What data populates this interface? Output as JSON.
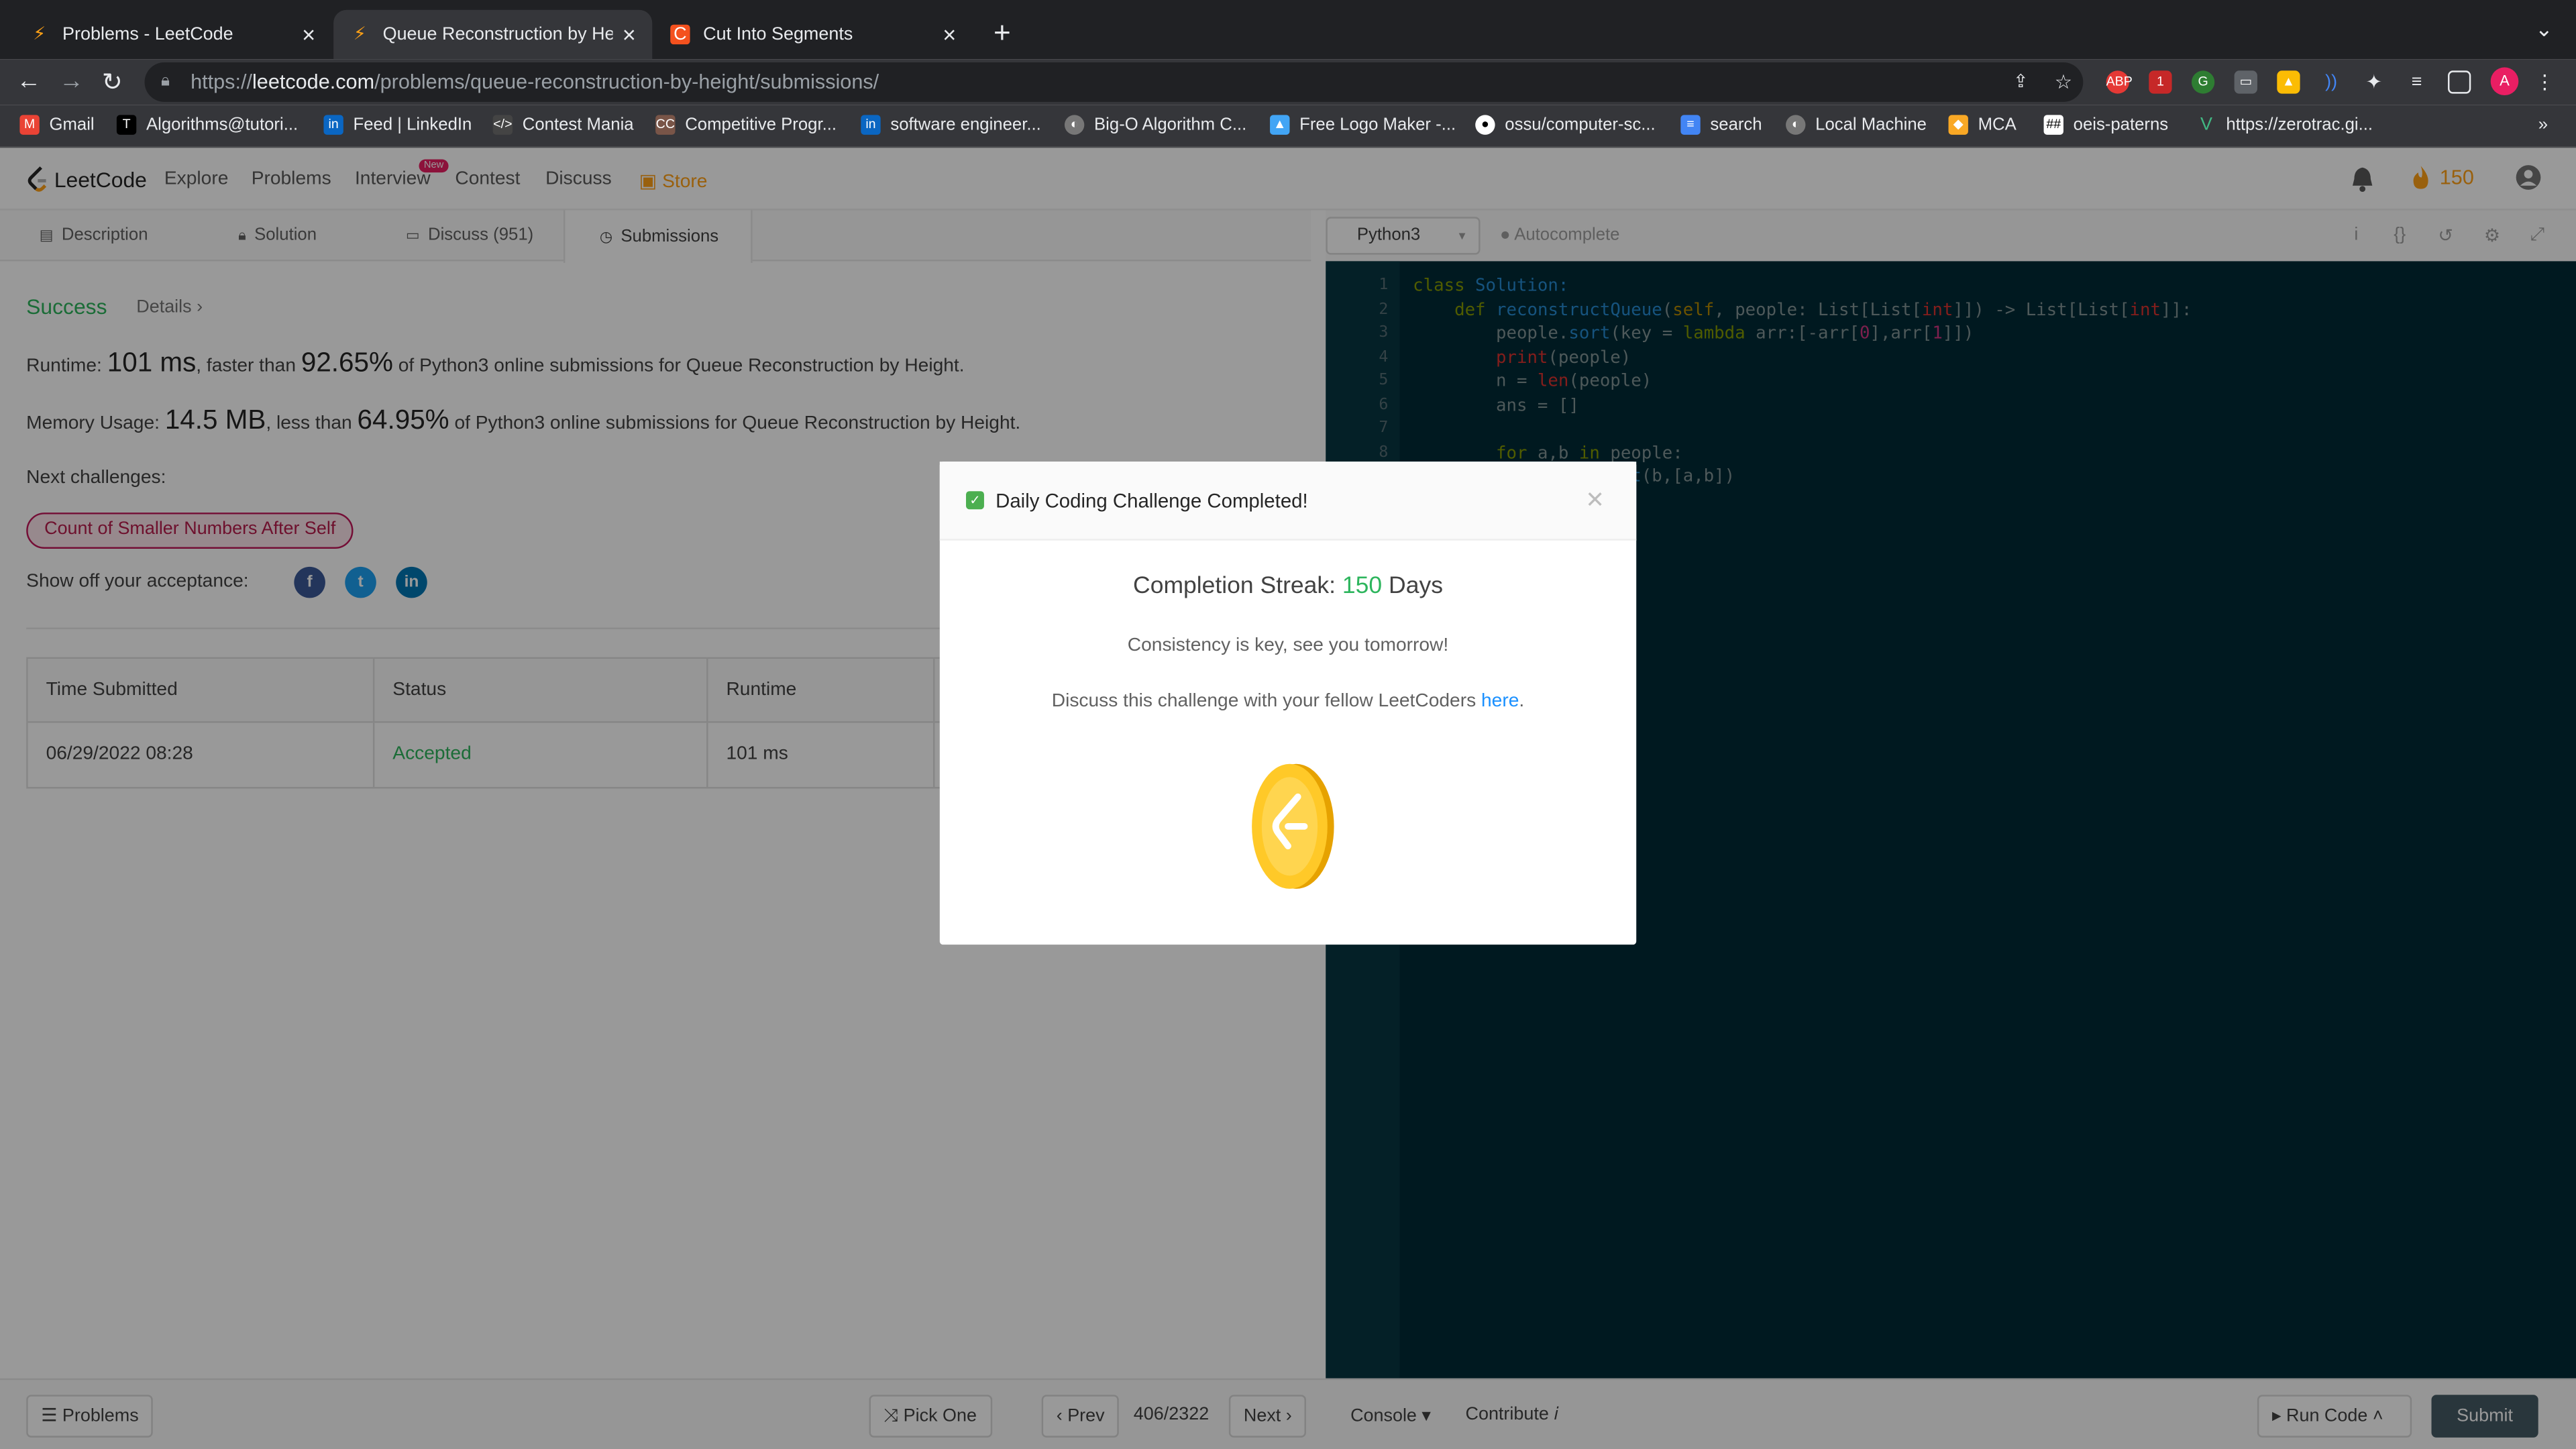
{
  "browser": {
    "tabs": [
      {
        "title": "Problems - LeetCode",
        "active": false
      },
      {
        "title": "Queue Reconstruction by Heig",
        "active": true
      },
      {
        "title": "Cut Into Segments",
        "active": false
      }
    ],
    "url_host": "leetcode.com",
    "url_prefix": "https://",
    "url_path": "/problems/queue-reconstruction-by-height/submissions/",
    "bookmarks": [
      "Gmail",
      "Algorithms@tutori...",
      "Feed | LinkedIn",
      "Contest Mania",
      "Competitive Progr...",
      "software engineer...",
      "Big-O Algorithm C...",
      "Free Logo Maker -...",
      "ossu/computer-sc...",
      "search",
      "Local Machine",
      "MCA",
      "oeis-paterns",
      "https://zerotrac.gi..."
    ]
  },
  "lcnav": {
    "logo": "LeetCode",
    "links": [
      "Explore",
      "Problems",
      "Interview",
      "Contest",
      "Discuss",
      "Store"
    ],
    "new_badge": "New",
    "streak": "150"
  },
  "tabs": {
    "description": "Description",
    "solution": "Solution",
    "discuss": "Discuss (951)",
    "submissions": "Submissions"
  },
  "result": {
    "status": "Success",
    "details": "Details",
    "runtime_label": "Runtime:",
    "runtime_value": "101 ms",
    "runtime_mid": ", faster than",
    "runtime_pct": "92.65%",
    "runtime_tail": "of Python3 online submissions for Queue Reconstruction by Height.",
    "memory_label": "Memory Usage:",
    "memory_value": "14.5 MB",
    "memory_mid": ", less than",
    "memory_pct": "64.95%",
    "memory_tail": "of Python3 online submissions for Queue Reconstruction by Height.",
    "next_label": "Next challenges:",
    "next_chip": "Count of Smaller Numbers After Self",
    "showoff": "Show off your acceptance:"
  },
  "submissions": {
    "headers": [
      "Time Submitted",
      "Status",
      "Runtime"
    ],
    "rows": [
      [
        "06/29/2022 08:28",
        "Accepted",
        "101 ms"
      ]
    ]
  },
  "editor": {
    "language": "Python3",
    "autocomplete": "Autocomplete",
    "line_numbers": [
      "1",
      "2",
      "3",
      "4",
      "5",
      "6",
      "7",
      "8"
    ]
  },
  "bottom": {
    "problems": "Problems",
    "pick_one": "Pick One",
    "prev": "Prev",
    "counter": "406/2322",
    "next": "Next",
    "console": "Console",
    "contribute": "Contribute",
    "run_code": "Run Code",
    "submit": "Submit"
  },
  "modal": {
    "title": "Daily Coding Challenge Completed!",
    "streak_label": "Completion Streak:",
    "streak_num": "150",
    "streak_unit": "Days",
    "line1": "Consistency is key, see you tomorrow!",
    "line2": "Discuss this challenge with your fellow LeetCoders",
    "link": "here"
  },
  "colors": {
    "success": "#2db55d",
    "accent": "#ffa116",
    "submit": "#455a64"
  }
}
